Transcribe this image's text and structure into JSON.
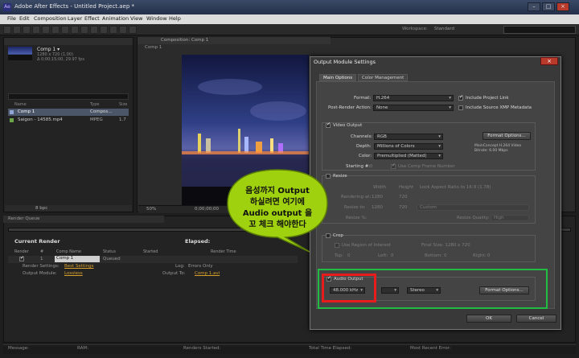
{
  "window": {
    "title": "Adobe After Effects - Untitled Project.aep *",
    "icon_text": "Ae"
  },
  "menu": [
    "File",
    "Edit",
    "Composition",
    "Layer",
    "Effect",
    "Animation",
    "View",
    "Window",
    "Help"
  ],
  "toolbar": {
    "workspace_label": "Workspace:",
    "workspace_value": "Standard"
  },
  "project": {
    "comp_name": "Comp 1 ▾",
    "comp_meta": [
      "1280 x 720 (1.00)",
      "Δ 0;00;15;00, 29.97 fps"
    ],
    "columns": [
      "Name",
      "Type",
      "Size"
    ],
    "items": [
      {
        "name": "Comp 1",
        "type": "Compos...",
        "size": ""
      },
      {
        "name": "Saigon - 14585.mp4",
        "type": "MPEG",
        "size": "1.7"
      }
    ],
    "bpc": "8 bpc"
  },
  "composition": {
    "tab": "Composition: Comp 1",
    "crumb": "Comp 1",
    "zoom": "50%",
    "timecode": "0;00;00;00"
  },
  "render_queue": {
    "tab": "Render Queue",
    "current_render": "Current Render",
    "elapsed": "Elapsed:",
    "columns": [
      "Render",
      "#",
      "Comp Name",
      "Status",
      "Started",
      "Render Time"
    ],
    "row": {
      "num": "1",
      "comp": "Comp 1",
      "status": "Queued"
    },
    "render_settings_label": "Render Settings:",
    "render_settings_value": "Best Settings",
    "output_module_label": "Output Module:",
    "output_module_value": "Lossless",
    "log_label": "Log:",
    "log_value": "Errors Only",
    "output_to_label": "Output To:",
    "output_to_value": "Comp 1.avi"
  },
  "status_bar": [
    "Message:",
    "RAM:",
    "Renders Started:",
    "Total Time Elapsed:",
    "Most Recent Error:"
  ],
  "dialog": {
    "title": "Output Module Settings",
    "tabs": [
      "Main Options",
      "Color Management"
    ],
    "format_label": "Format:",
    "format_value": "H.264",
    "post_render_label": "Post-Render Action:",
    "post_render_value": "None",
    "include_project_link": "Include Project Link",
    "include_xmp": "Include Source XMP Metadata",
    "video_output": "Video Output",
    "channels_label": "Channels:",
    "channels_value": "RGB",
    "depth_label": "Depth:",
    "depth_value": "Millions of Colors",
    "color_label": "Color:",
    "color_value": "Premultiplied (Matted)",
    "format_options": "Format Options...",
    "codec_info": [
      "MainConcept H.264 Video",
      "Bitrate: 6.00 Mbps"
    ],
    "starting_label": "Starting #:",
    "starting_value": "0",
    "use_comp_frame": "Use Comp Frame Number",
    "resize": "Resize",
    "resize_width": "Width",
    "resize_height": "Height",
    "lock_aspect": "Lock Aspect Ratio to 16:9 (1.78)",
    "rendering_at": "Rendering at:",
    "rendering_w": "1280",
    "rendering_h": "720",
    "resize_to": "Resize to:",
    "resize_to_w": "1280",
    "resize_to_h": "720",
    "resize_to_preset": "Custom",
    "resize_pct": "Resize %:",
    "resize_quality_label": "Resize Quality:",
    "resize_quality_value": "High",
    "crop": "Crop",
    "use_roi": "Use Region of Interest",
    "final_size": "Final Size: 1280 x 720",
    "crop_top": "Top:",
    "crop_left": "Left:",
    "crop_bottom": "Bottom:",
    "crop_right": "Right:",
    "crop_zero": "0",
    "audio_output": "Audio Output",
    "audio_rate": "48.000 kHz",
    "audio_channels": "Stereo",
    "audio_format_options": "Format Options...",
    "ok": "OK",
    "cancel": "Cancel"
  },
  "annotation": {
    "lines": [
      "음성까지 Output",
      "하실려면 여기에",
      "Audio output 을",
      "꼬 체크 해야한다"
    ],
    "bubble_color": "#9fd10f",
    "highlight_red": "#e81c1c",
    "highlight_green": "#22bb44"
  }
}
